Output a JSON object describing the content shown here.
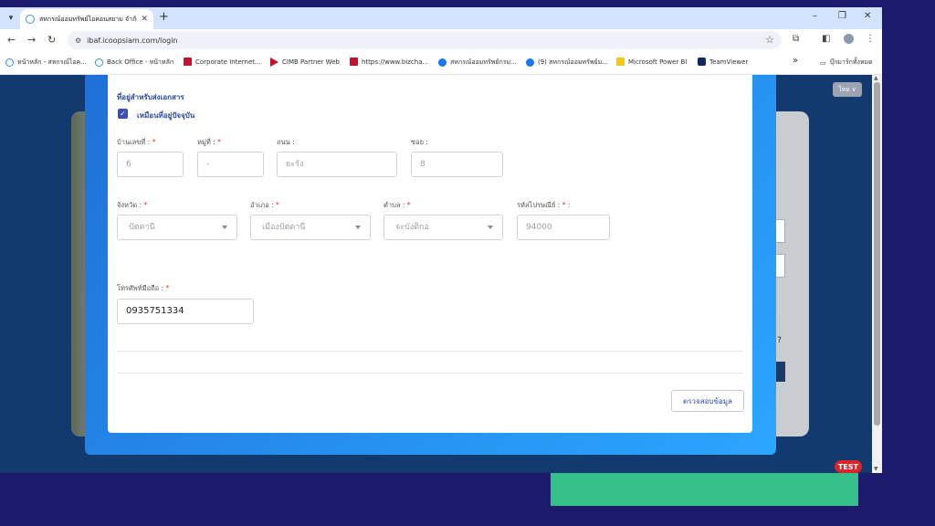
{
  "browser": {
    "tab": {
      "title": "สหกรณ์ออมทรัพย์ไอคอนสยาม จำกัด",
      "close": "✕"
    },
    "new_tab": "+",
    "window_controls": {
      "minimize": "–",
      "restore": "❐",
      "close": "✕"
    },
    "url": "ibaf.icoopsiam.com/login",
    "bookmarks": [
      {
        "label": "หน้าหลัก - สหกรณ์ไอค...",
        "icon": "globe-icon"
      },
      {
        "label": "Back Office - หน้าหลัก",
        "icon": "globe-icon"
      },
      {
        "label": "Corporate Internet...",
        "icon": "bank-icon"
      },
      {
        "label": "CIMB Partner Web",
        "icon": "cimb-icon"
      },
      {
        "label": "https://www.bizcha...",
        "icon": "bank-icon"
      },
      {
        "label": "สหกรณ์ออมทรัพย์กรม...",
        "icon": "facebook-icon"
      },
      {
        "label": "(9) สหกรณ์ออมทรัพย์ม...",
        "icon": "facebook-icon"
      },
      {
        "label": "Microsoft Power BI",
        "icon": "powerbi-icon"
      },
      {
        "label": "TeamViewer",
        "icon": "teamviewer-icon"
      }
    ],
    "bookmarks_overflow": "»",
    "all_bookmarks": "บุ๊กมาร์กทั้งหมด"
  },
  "page": {
    "language": "ไทย ∨",
    "test_badge": "TEST"
  },
  "form": {
    "section_title": "ที่อยู่สำหรับส่งเอกสาร",
    "same_as_current": {
      "label": "เหมือนที่อยู่ปัจจุบัน",
      "checked": true
    },
    "house_no": {
      "label": "บ้านเลขที่ :",
      "required": "*",
      "value": "6"
    },
    "moo": {
      "label": "หมู่ที่ :",
      "required": "*",
      "value": "-"
    },
    "road": {
      "label": "ถนน :",
      "value": "ยะรัง"
    },
    "soi": {
      "label": "ซอย :",
      "value": "8"
    },
    "province": {
      "label": "จังหวัด :",
      "required": "*",
      "value": "ปัตตานี"
    },
    "district": {
      "label": "อำเภอ :",
      "required": "*",
      "value": "เมืองปัตตานี"
    },
    "subdistrict": {
      "label": "ตำบล :",
      "required": "*",
      "value": "จะบังติกอ"
    },
    "postal_code": {
      "label": "รหัสไปรษณีย์ :",
      "required": "* :",
      "value": "94000"
    },
    "mobile": {
      "label": "โทรศัพท์มือถือ :",
      "required": "*",
      "value": "0935751334"
    },
    "verify_button": "ตรวจสอบข้อมูล"
  },
  "colors": {
    "accent": "#2c4a9e",
    "modal_frame": "#1f6fd8",
    "background": "#1c1a6b",
    "highlight_bar": "#35c089",
    "test_badge": "#d9262c"
  }
}
